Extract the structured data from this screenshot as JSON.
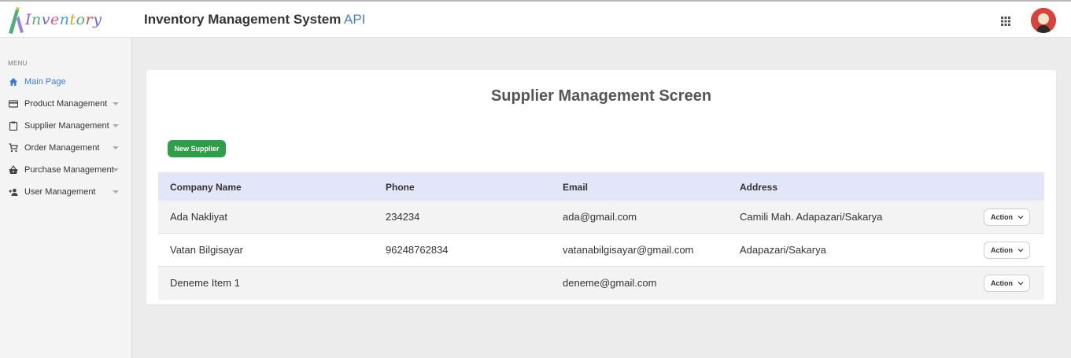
{
  "header": {
    "logo_text": "Inventory",
    "title": "Inventory Management System",
    "api_link": "API",
    "apps_icon": "grid-icon",
    "avatar_icon": "user-avatar"
  },
  "sidebar": {
    "menu_label": "MENU",
    "items": [
      {
        "label": "Main Page",
        "icon": "home-icon",
        "active": true
      },
      {
        "label": "Product Management",
        "icon": "card-icon"
      },
      {
        "label": "Supplier Management",
        "icon": "clipboard-icon"
      },
      {
        "label": "Order Management",
        "icon": "cart-icon"
      },
      {
        "label": "Purchase Management",
        "icon": "basket-icon"
      },
      {
        "label": "User Management",
        "icon": "add-user-icon"
      }
    ]
  },
  "main": {
    "title": "Supplier Management Screen",
    "new_button": "New Supplier",
    "table": {
      "headers": [
        "Company Name",
        "Phone",
        "Email",
        "Address"
      ],
      "rows": [
        {
          "company": "Ada Nakliyat",
          "phone": "234234",
          "email": "ada@gmail.com",
          "address": "Camili Mah. Adapazari/Sakarya",
          "action": "Action"
        },
        {
          "company": "Vatan Bilgisayar",
          "phone": "96248762834",
          "email": "vatanabilgisayar@gmail.com",
          "address": "Adapazari/Sakarya",
          "action": "Action"
        },
        {
          "company": "Deneme Item 1",
          "phone": "",
          "email": "deneme@gmail.com",
          "address": "",
          "action": "Action"
        }
      ]
    }
  },
  "colors": {
    "accent_blue": "#3b7be0",
    "new_button_green": "#2e9e4a",
    "table_header_bg": "#e3e5f8"
  }
}
